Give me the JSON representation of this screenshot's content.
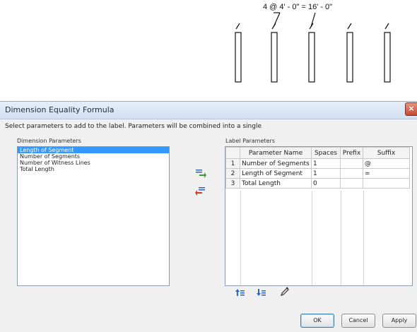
{
  "drawing": {
    "dimension_label": "4 @ 4' - 0\" = 16' - 0\""
  },
  "dialog": {
    "title": "Dimension Equality Formula",
    "close_glyph": "×",
    "instruction": "Select parameters to add to the label. Parameters will be combined into a single",
    "dimension_parameters": {
      "label": "Dimension Parameters",
      "items": [
        {
          "label": "Length of Segment",
          "selected": true
        },
        {
          "label": "Number of Segments",
          "selected": false
        },
        {
          "label": "Number of Witness Lines",
          "selected": false
        },
        {
          "label": "Total Length",
          "selected": false
        }
      ]
    },
    "label_parameters": {
      "label": "Label Parameters",
      "headers": [
        "Parameter Name",
        "Spaces",
        "Prefix",
        "Suffix"
      ],
      "rows": [
        {
          "num": "1",
          "name": "Number of Segments",
          "spaces": "1",
          "prefix": "",
          "suffix": "@"
        },
        {
          "num": "2",
          "name": "Length of Segment",
          "spaces": "1",
          "prefix": "",
          "suffix": "="
        },
        {
          "num": "3",
          "name": "Total Length",
          "spaces": "0",
          "prefix": "",
          "suffix": ""
        }
      ]
    },
    "buttons": {
      "ok": "OK",
      "cancel": "Cancel",
      "apply": "Apply"
    },
    "colors": {
      "accent_green": "#3a9a3a",
      "accent_red": "#d03a2a",
      "accent_blue": "#2a66c4",
      "selection": "#3399ff"
    }
  }
}
